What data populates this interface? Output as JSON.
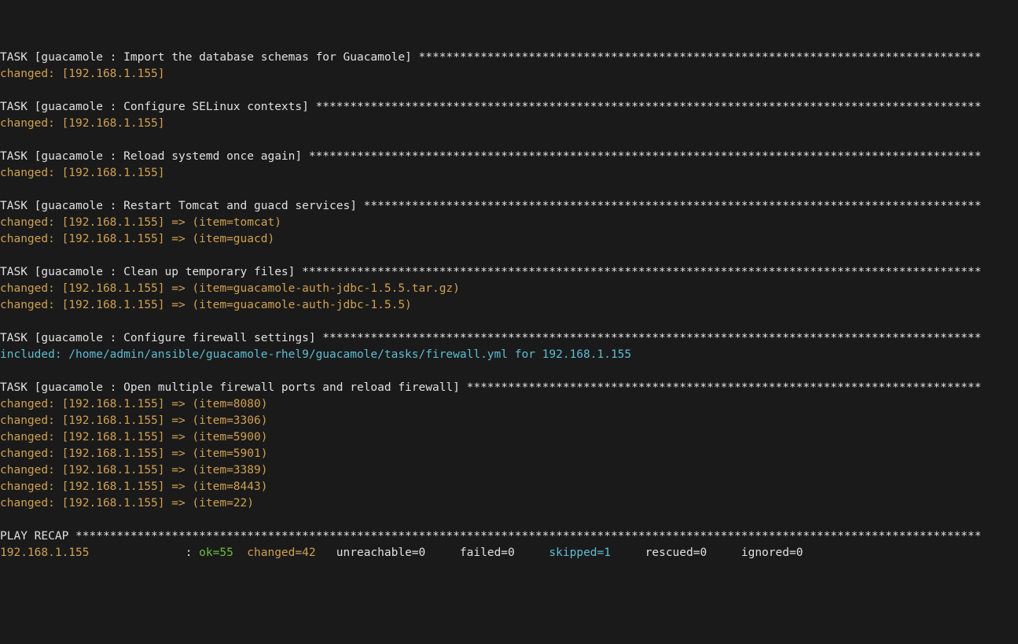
{
  "host": "192.168.1.155",
  "tasks": [
    {
      "name": "Import the database schemas for Guacamole",
      "results": [
        {
          "status": "changed",
          "item": null
        }
      ]
    },
    {
      "name": "Configure SELinux contexts",
      "results": [
        {
          "status": "changed",
          "item": null
        }
      ]
    },
    {
      "name": "Reload systemd once again",
      "results": [
        {
          "status": "changed",
          "item": null
        }
      ]
    },
    {
      "name": "Restart Tomcat and guacd services",
      "results": [
        {
          "status": "changed",
          "item": "tomcat"
        },
        {
          "status": "changed",
          "item": "guacd"
        }
      ]
    },
    {
      "name": "Clean up temporary files",
      "results": [
        {
          "status": "changed",
          "item": "guacamole-auth-jdbc-1.5.5.tar.gz"
        },
        {
          "status": "changed",
          "item": "guacamole-auth-jdbc-1.5.5"
        }
      ]
    },
    {
      "name": "Configure firewall settings",
      "included": "/home/admin/ansible/guacamole-rhel9/guacamole/tasks/firewall.yml for 192.168.1.155"
    },
    {
      "name": "Open multiple firewall ports and reload firewall",
      "results": [
        {
          "status": "changed",
          "item": "8080"
        },
        {
          "status": "changed",
          "item": "3306"
        },
        {
          "status": "changed",
          "item": "5900"
        },
        {
          "status": "changed",
          "item": "5901"
        },
        {
          "status": "changed",
          "item": "3389"
        },
        {
          "status": "changed",
          "item": "8443"
        },
        {
          "status": "changed",
          "item": "22"
        }
      ]
    }
  ],
  "line_width": 143,
  "role": "guacamole",
  "recap": {
    "host": "192.168.1.155",
    "ok": 55,
    "changed": 42,
    "unreachable": 0,
    "failed": 0,
    "skipped": 1,
    "rescued": 0,
    "ignored": 0
  }
}
